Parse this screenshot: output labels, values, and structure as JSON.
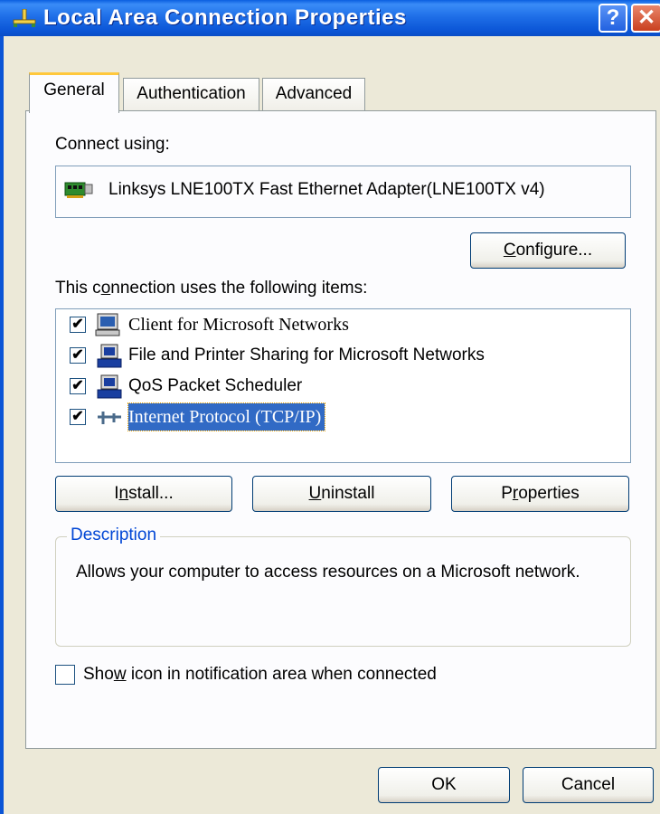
{
  "window": {
    "title": "Local Area Connection Properties",
    "help_glyph": "?",
    "close_glyph": "✕"
  },
  "tabs": [
    {
      "label": "General",
      "active": true
    },
    {
      "label": "Authentication",
      "active": false
    },
    {
      "label": "Advanced",
      "active": false
    }
  ],
  "connect_using": {
    "label": "Connect using:",
    "adapter": "Linksys LNE100TX Fast Ethernet Adapter(LNE100TX v4)",
    "adapter_icon": "network-adapter-icon",
    "configure_button": {
      "pre": "",
      "mnemonic": "C",
      "post": "onfigure..."
    }
  },
  "items_section": {
    "label": {
      "pre": "This c",
      "mnemonic": "o",
      "post": "nnection uses the following items:"
    },
    "items": [
      {
        "label": "Client for Microsoft Networks",
        "checked": true,
        "icon": "network-client-icon",
        "selected": false
      },
      {
        "label": "File and Printer Sharing for Microsoft Networks",
        "checked": true,
        "icon": "network-service-icon",
        "selected": false
      },
      {
        "label": "QoS Packet Scheduler",
        "checked": true,
        "icon": "network-service-icon",
        "selected": false
      },
      {
        "label": "Internet Protocol (TCP/IP)",
        "checked": true,
        "icon": "network-protocol-icon",
        "selected": true
      }
    ],
    "check_glyph": "✔"
  },
  "buttons": {
    "install": {
      "pre": "I",
      "mnemonic": "n",
      "post": "stall..."
    },
    "uninstall": {
      "pre": "",
      "mnemonic": "U",
      "post": "ninstall"
    },
    "properties": {
      "pre": "P",
      "mnemonic": "r",
      "post": "operties"
    }
  },
  "description": {
    "title": "Description",
    "text": "Allows your computer to access resources on a Microsoft network."
  },
  "notification": {
    "label": {
      "pre": "Sho",
      "mnemonic": "w",
      "post": " icon in notification area when connected"
    },
    "checked": false
  },
  "footer": {
    "ok": "OK",
    "cancel": "Cancel"
  },
  "colors": {
    "titlebar": "#0b55d6",
    "selection": "#316ac5",
    "dialog_bg": "#ece9d8",
    "group_title": "#0046d5"
  }
}
